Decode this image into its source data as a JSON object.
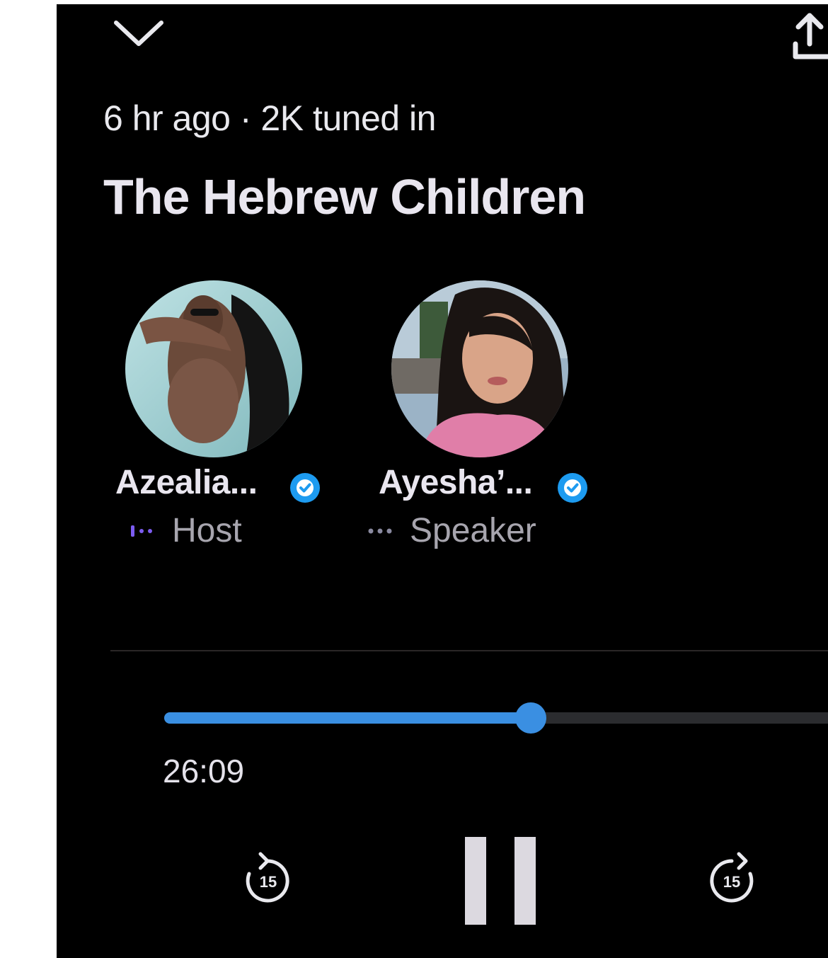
{
  "header": {
    "collapse_icon": "chevron-down-icon",
    "share_icon": "share-upload-icon"
  },
  "space": {
    "meta": "6 hr ago · 2K tuned in",
    "title": "The Hebrew Children"
  },
  "participants": [
    {
      "name": "Azealia...",
      "role": "Host",
      "verified": true,
      "role_dots_color": "#7c5cf0"
    },
    {
      "name": "Ayesha’...",
      "role": "Speaker",
      "verified": true,
      "role_dots_color": "#8a8aa0"
    }
  ],
  "playback": {
    "elapsed": "26:09",
    "progress_fraction": 0.545,
    "rewind_seconds": "15",
    "forward_seconds": "15",
    "state_icon": "pause-icon"
  },
  "colors": {
    "accent": "#3a8fe2",
    "verified": "#1d9bf0",
    "background": "#000000",
    "text": "#e9e6ef",
    "muted": "#a7a5ae"
  }
}
